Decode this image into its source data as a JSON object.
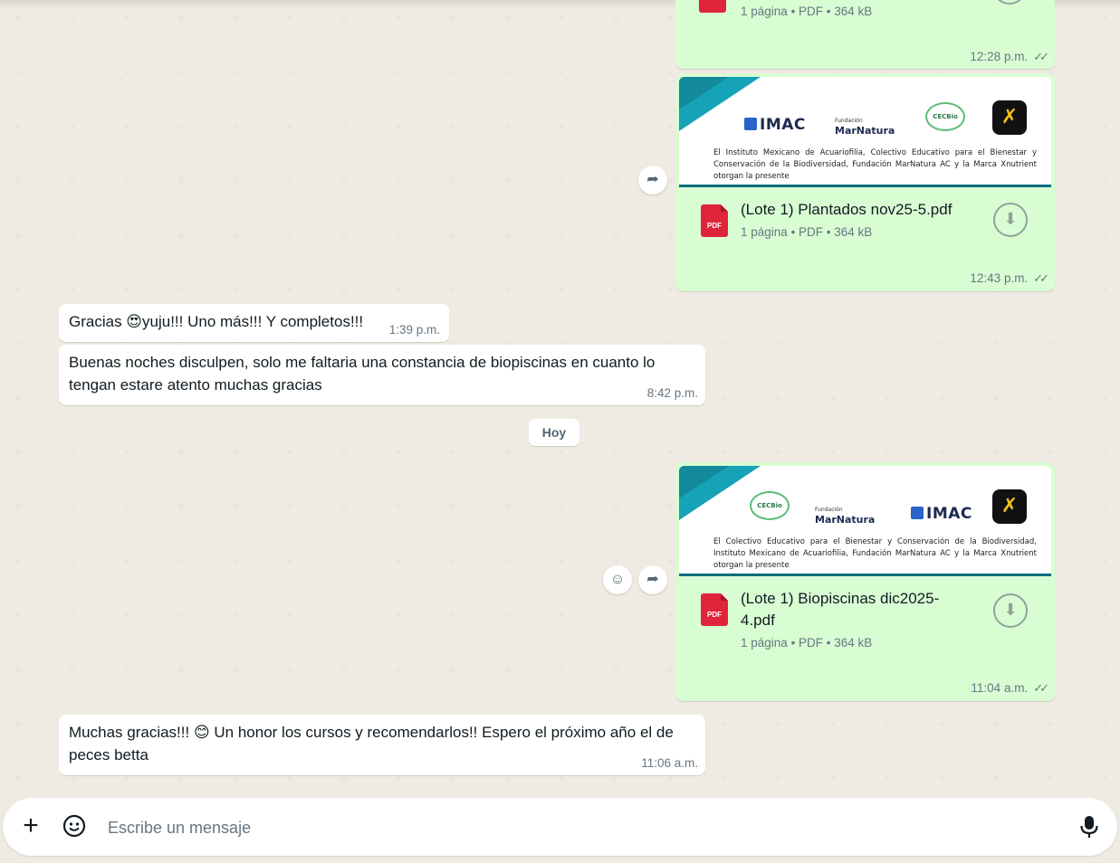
{
  "chat": {
    "msg1": {
      "file_pages": "1 página",
      "file_type": "PDF",
      "file_size": "364 kB",
      "time": "12:28 p.m."
    },
    "msg2": {
      "preview_logos": [
        "IMAC",
        "Fundación",
        "MarNatura",
        "CECBio"
      ],
      "preview_text": "El Instituto Mexicano de Acuariofilia, Colectivo Educativo para el Bienestar y Conservación de la Biodiversidad, Fundación MarNatura AC y la Marca Xnutrient otorgan la presente",
      "file_name": "(Lote 1) Plantados nov25-5.pdf",
      "file_pages": "1 página",
      "file_type": "PDF",
      "file_size": "364 kB",
      "time": "12:43 p.m."
    },
    "msg3": {
      "text": "Gracias 😍yuju!!! Uno más!!! Y completos!!!",
      "time": "1:39 p.m."
    },
    "msg4": {
      "text": "Buenas noches disculpen, solo  me faltaria una constancia de biopiscinas en cuanto lo tengan estare atento muchas gracias",
      "time": "8:42 p.m."
    },
    "date_divider": "Hoy",
    "msg5": {
      "preview_logos": [
        "CECBio",
        "Fundación",
        "MarNatura",
        "IMAC"
      ],
      "preview_text": "El Colectivo Educativo para el Bienestar y Conservación de la Biodiversidad, Instituto Mexicano de Acuariofilia, Fundación MarNatura AC y la Marca Xnutrient otorgan la presente",
      "file_name": "(Lote 1) Biopiscinas dic2025-4.pdf",
      "file_pages": "1 página",
      "file_type": "PDF",
      "file_size": "364 kB",
      "time": "11:04 a.m."
    },
    "msg6": {
      "text": "Muchas gracias!!! 😊 Un honor los cursos y recomendarlos!! Espero el próximo año el de peces betta",
      "time": "11:06 a.m."
    }
  },
  "composer": {
    "placeholder": "Escribe un mensaje"
  },
  "icons": [
    "pdf-icon",
    "download-icon",
    "double-check-icon",
    "forward-icon",
    "emoji-react-icon",
    "plus-icon",
    "sticker-icon",
    "microphone-icon"
  ],
  "colors": {
    "outgoing_bubble": "#d9fdd3",
    "incoming_bubble": "#ffffff",
    "wallpaper": "#efeae2",
    "pdf_red": "#e0243b"
  }
}
